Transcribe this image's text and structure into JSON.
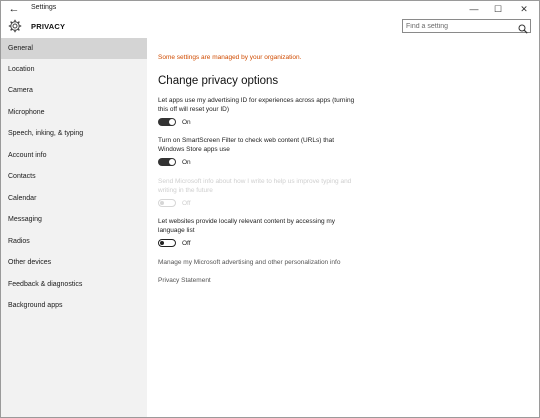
{
  "titlebar": {
    "back_glyph": "←",
    "title": "Settings",
    "min_glyph": "—",
    "max_glyph": "☐",
    "close_glyph": "✕"
  },
  "header": {
    "title": "PRIVACY",
    "search_placeholder": "Find a setting"
  },
  "sidebar": {
    "items": [
      {
        "label": "General",
        "selected": true
      },
      {
        "label": "Location"
      },
      {
        "label": "Camera"
      },
      {
        "label": "Microphone"
      },
      {
        "label": "Speech, inking, & typing"
      },
      {
        "label": "Account info"
      },
      {
        "label": "Contacts"
      },
      {
        "label": "Calendar"
      },
      {
        "label": "Messaging"
      },
      {
        "label": "Radios"
      },
      {
        "label": "Other devices"
      },
      {
        "label": "Feedback & diagnostics"
      },
      {
        "label": "Background apps"
      }
    ]
  },
  "main": {
    "org_message": "Some settings are managed by your organization.",
    "heading": "Change privacy options",
    "options": [
      {
        "description": "Let apps use my advertising ID for experiences across apps (turning this off will reset your ID)",
        "state": "On",
        "enabled": true
      },
      {
        "description": "Turn on SmartScreen Filter to check web content (URLs) that Windows Store apps use",
        "state": "On",
        "enabled": true
      },
      {
        "description": "Send Microsoft info about how I write to help us improve typing and writing in the future",
        "state": "Off",
        "enabled": false
      },
      {
        "description": "Let websites provide locally relevant content by accessing my language list",
        "state": "Off",
        "enabled": true
      }
    ],
    "advertising_link": "Manage my Microsoft advertising and other personalization info",
    "privacy_link": "Privacy Statement"
  },
  "colors": {
    "org_message": "#d04b00",
    "selected_nav": "#d4d4d4",
    "sidebar_bg": "#f2f2f2"
  }
}
